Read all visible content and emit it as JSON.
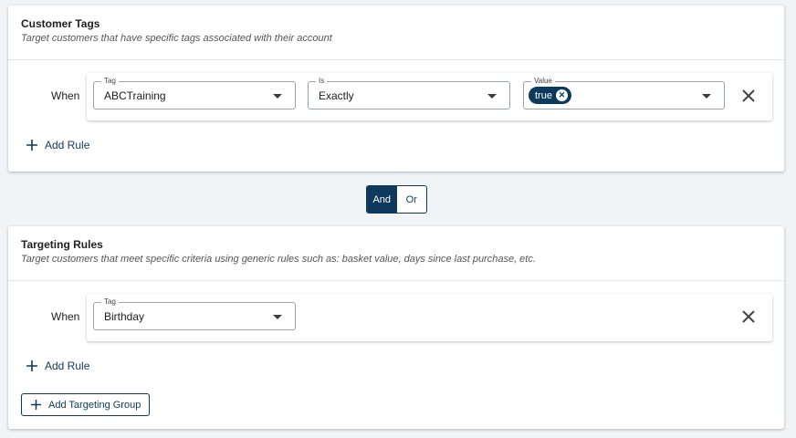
{
  "customer_tags": {
    "title": "Customer Tags",
    "description": "Target customers that have specific tags associated with their account",
    "rule": {
      "when": "When",
      "tag": {
        "label": "Tag",
        "value": "ABCTraining"
      },
      "is": {
        "label": "Is",
        "value": "Exactly"
      },
      "value": {
        "label": "Value",
        "chips": [
          "true"
        ]
      }
    },
    "add_rule": "Add Rule"
  },
  "logic_toggle": {
    "and": "And",
    "or": "Or",
    "selected": "And"
  },
  "targeting_rules": {
    "title": "Targeting Rules",
    "description": "Target customers that meet specific criteria using generic rules such as: basket value, days since last purchase, etc.",
    "rule": {
      "when": "When",
      "tag": {
        "label": "Tag",
        "value": "Birthday"
      }
    },
    "add_rule": "Add Rule",
    "add_group": "Add Targeting Group"
  },
  "colors": {
    "primary": "#0d3a5c",
    "background": "#f1f4f7",
    "border": "#9aa3ab"
  }
}
